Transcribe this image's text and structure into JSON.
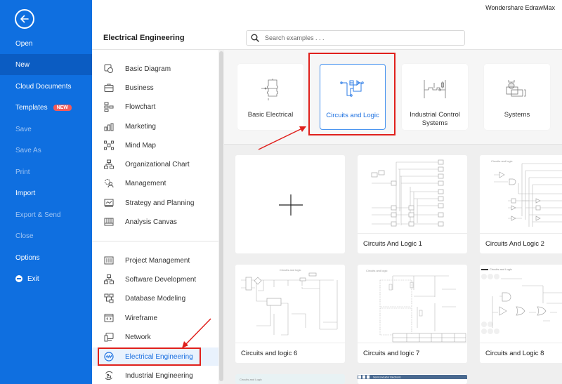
{
  "app": {
    "title": "Wondershare EdrawMax"
  },
  "sidebar": {
    "back_icon": "back-arrow-circle-icon",
    "items": [
      {
        "label": "Open",
        "state": "normal"
      },
      {
        "label": "New",
        "state": "active"
      },
      {
        "label": "Cloud Documents",
        "state": "normal"
      },
      {
        "label": "Templates",
        "state": "normal",
        "badge": "NEW"
      },
      {
        "label": "Save",
        "state": "disabled"
      },
      {
        "label": "Save As",
        "state": "disabled"
      },
      {
        "label": "Print",
        "state": "disabled"
      },
      {
        "label": "Import",
        "state": "normal"
      },
      {
        "label": "Export & Send",
        "state": "disabled"
      },
      {
        "label": "Close",
        "state": "disabled"
      },
      {
        "label": "Options",
        "state": "normal"
      },
      {
        "label": "Exit",
        "state": "normal",
        "icon": "exit-icon"
      }
    ],
    "colors": {
      "background": "#0f6fe0",
      "active": "#0b5cc2",
      "badge": "#f25a5a"
    }
  },
  "categories": {
    "title": "Electrical Engineering",
    "group1": [
      {
        "label": "Basic Diagram",
        "icon": "basic-diagram-icon"
      },
      {
        "label": "Business",
        "icon": "briefcase-icon"
      },
      {
        "label": "Flowchart",
        "icon": "flowchart-icon"
      },
      {
        "label": "Marketing",
        "icon": "bar-chart-icon"
      },
      {
        "label": "Mind Map",
        "icon": "mind-map-icon"
      },
      {
        "label": "Organizational Chart",
        "icon": "org-chart-icon"
      },
      {
        "label": "Management",
        "icon": "management-icon"
      },
      {
        "label": "Strategy and Planning",
        "icon": "strategy-icon"
      },
      {
        "label": "Analysis Canvas",
        "icon": "analysis-canvas-icon"
      }
    ],
    "group2": [
      {
        "label": "Project Management",
        "icon": "project-management-icon"
      },
      {
        "label": "Software Development",
        "icon": "software-development-icon"
      },
      {
        "label": "Database Modeling",
        "icon": "database-icon"
      },
      {
        "label": "Wireframe",
        "icon": "wireframe-icon"
      },
      {
        "label": "Network",
        "icon": "network-icon"
      },
      {
        "label": "Electrical Engineering",
        "icon": "electrical-icon",
        "active": true
      },
      {
        "label": "Industrial Engineering",
        "icon": "industrial-icon"
      }
    ]
  },
  "search": {
    "placeholder": "Search examples . . ."
  },
  "subcategories": [
    {
      "label": "Basic Electrical"
    },
    {
      "label": "Circuits and Logic",
      "selected": true
    },
    {
      "label": "Industrial Control Systems"
    },
    {
      "label": "Systems"
    }
  ],
  "templates": [
    {
      "label": "",
      "type": "blank",
      "icon": "plus-icon"
    },
    {
      "label": "Circuits And Logic 1"
    },
    {
      "label": "Circuits And Logic 2"
    },
    {
      "label": "Circuits and logic 6",
      "preview_title": "Circuits and logic"
    },
    {
      "label": "Circuits and logic 7",
      "preview_title": "Circuits and logic"
    },
    {
      "label": "Circuits and Logic 8",
      "preview_title": "Circuits and Logic"
    },
    {
      "label": "",
      "preview_title": "Circuits and Logic"
    },
    {
      "label": "",
      "preview_title": "Semiconductor Electronic"
    }
  ],
  "annotations": {
    "highlight_color": "#e0201c"
  }
}
